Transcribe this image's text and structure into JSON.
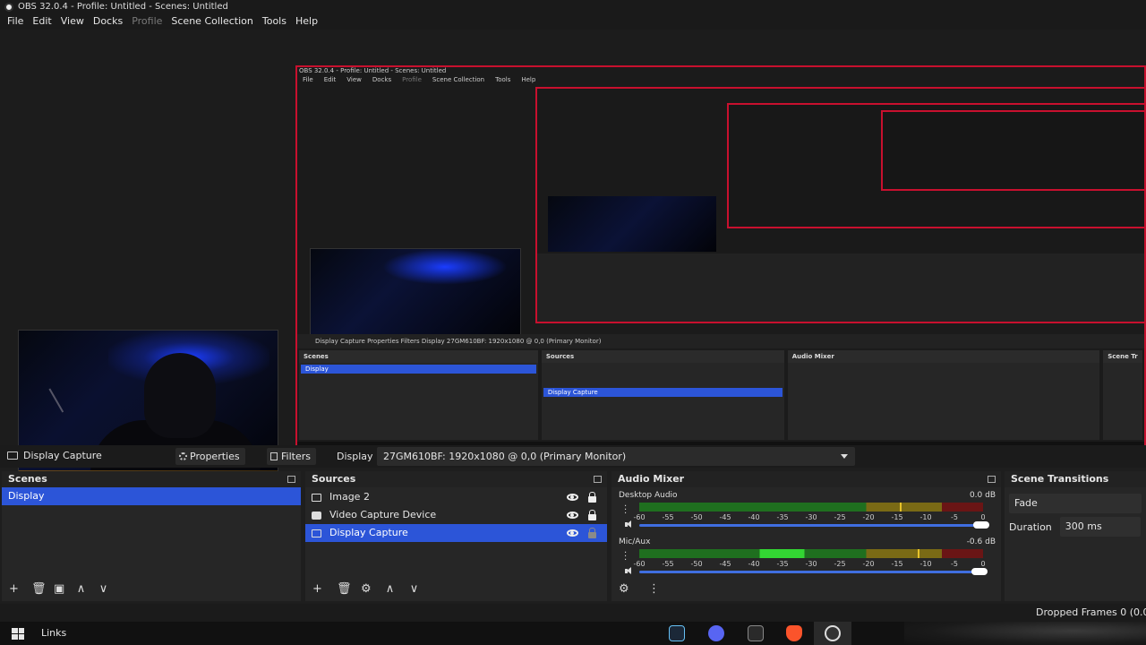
{
  "window": {
    "title": "OBS 32.0.4 - Profile: Untitled - Scenes: Untitled"
  },
  "menu": [
    "File",
    "Edit",
    "View",
    "Docks",
    "Profile",
    "Scene Collection",
    "Tools",
    "Help"
  ],
  "nested_preview": {
    "title": "OBS 32.0.4 - Profile: Untitled - Scenes: Untitled",
    "menu": [
      "File",
      "Edit",
      "View",
      "Docks",
      "Profile",
      "Scene Collection",
      "Tools",
      "Help"
    ],
    "source_bar": "Display Capture    Properties    Filters    Display    27GM610BF: 1920x1080 @ 0,0 (Primary Monitor)",
    "panels": [
      "Scenes",
      "Sources",
      "Audio Mixer",
      "Scene Tr"
    ],
    "scene_sel": "Display",
    "source_sel": "Display Capture",
    "taskbar_label": "Links"
  },
  "source_toolbar": {
    "selected_source": "Display Capture",
    "properties_label": "Properties",
    "filters_label": "Filters",
    "display_label": "Display",
    "display_value": "27GM610BF: 1920x1080 @ 0,0 (Primary Monitor)"
  },
  "scenes": {
    "title": "Scenes",
    "items": [
      {
        "label": "Display",
        "selected": true
      }
    ],
    "toolbar": [
      "+",
      "🗑",
      "▣",
      "∧",
      "∨"
    ]
  },
  "sources": {
    "title": "Sources",
    "items": [
      {
        "label": "Image 2",
        "icon": "image-icon",
        "visible": true,
        "locked": true
      },
      {
        "label": "Video Capture Device",
        "icon": "camera-icon",
        "visible": true,
        "locked": true
      },
      {
        "label": "Display Capture",
        "icon": "monitor-icon",
        "visible": true,
        "locked": false,
        "selected": true
      }
    ]
  },
  "mixer": {
    "title": "Audio Mixer",
    "channels": [
      {
        "name": "Desktop Audio",
        "db": "0.0 dB"
      },
      {
        "name": "Mic/Aux",
        "db": "-0.6 dB"
      }
    ],
    "ticks": [
      "-60",
      "-55",
      "-50",
      "-45",
      "-40",
      "-35",
      "-30",
      "-25",
      "-20",
      "-15",
      "-10",
      "-5",
      "0"
    ]
  },
  "transitions": {
    "title": "Scene Transitions",
    "transition": "Fade",
    "duration_label": "Duration",
    "duration_value": "300 ms"
  },
  "status": {
    "dropped": "Dropped Frames 0 (0.0"
  },
  "taskbar": {
    "links": "Links"
  },
  "colors": {
    "selection": "#2c55d8",
    "preview_border": "#c8102e"
  }
}
